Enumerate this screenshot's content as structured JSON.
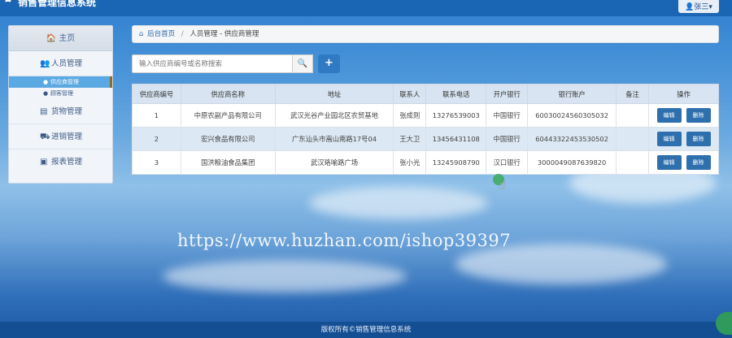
{
  "app": {
    "title": "销售管理信息系统",
    "user_label": "张三"
  },
  "sidebar": {
    "home": "主页",
    "items": [
      {
        "label": "人员管理",
        "icon": "users-icon"
      },
      {
        "label": "货物管理",
        "icon": "book-icon"
      },
      {
        "label": "进销管理",
        "icon": "truck-icon"
      },
      {
        "label": "报表管理",
        "icon": "chart-icon"
      }
    ],
    "sub_items": [
      {
        "label": "供应商管理",
        "active": true
      },
      {
        "label": "顾客管理",
        "active": false
      }
    ]
  },
  "breadcrumb": {
    "home": "后台首页",
    "current": "人员管理 - 供应商管理"
  },
  "search": {
    "placeholder": "输入供应商编号或名称搜索"
  },
  "table": {
    "headers": [
      "供应商编号",
      "供应商名称",
      "地址",
      "联系人",
      "联系电话",
      "开户银行",
      "银行账户",
      "备注",
      "操作"
    ],
    "rows": [
      {
        "id": "1",
        "name": "中原农副产品有限公司",
        "address": "武汉光谷产业园北区农贸基地",
        "contact": "张成则",
        "phone": "13276539003",
        "bank": "中国银行",
        "account": "600300245603050​32",
        "note": ""
      },
      {
        "id": "2",
        "name": "宏兴食品有限公司",
        "address": "广东汕头市嵩山南路17号04",
        "contact": "王大卫",
        "phone": "13456431108",
        "bank": "中国银行",
        "account": "60443322453530502",
        "note": ""
      },
      {
        "id": "3",
        "name": "国洪粮油食品集团",
        "address": "武汉珞喻路广场",
        "contact": "张小光",
        "phone": "13245908790",
        "bank": "汉口银行",
        "account": "3000049087639820",
        "note": ""
      }
    ],
    "edit_label": "编辑",
    "delete_label": "删除"
  },
  "watermark": "https://www.huzhan.com/ishop39397",
  "footer": "版权所有©销售管理信息系统"
}
